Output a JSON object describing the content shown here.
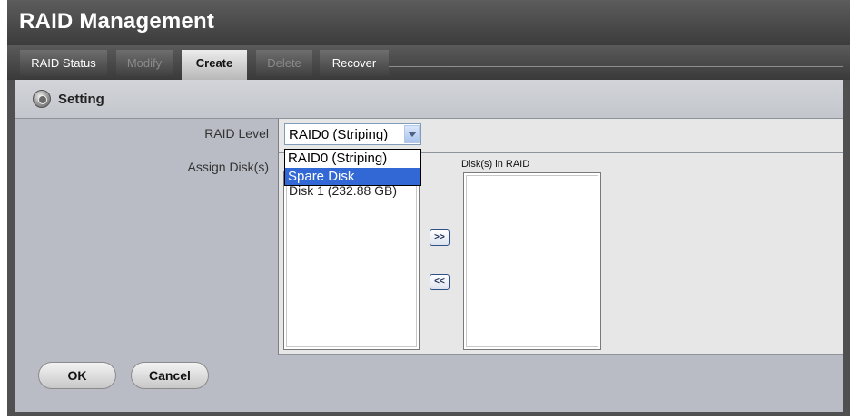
{
  "header": {
    "title": "RAID Management"
  },
  "tabs": [
    {
      "label": "RAID Status",
      "state": "normal"
    },
    {
      "label": "Modify",
      "state": "disabled"
    },
    {
      "label": "Create",
      "state": "active"
    },
    {
      "label": "Delete",
      "state": "disabled"
    },
    {
      "label": "Recover",
      "state": "normal"
    }
  ],
  "section": {
    "title": "Setting",
    "icon": "gear-icon"
  },
  "form": {
    "raid_level_label": "RAID Level",
    "raid_level_value": "RAID0 (Striping)",
    "raid_level_options": [
      "RAID0 (Striping)",
      "Spare Disk"
    ],
    "raid_level_highlighted": "Spare Disk",
    "assign_disks_label": "Assign Disk(s)",
    "available_disks": [
      "Disk 1 (232.88 GB)"
    ],
    "disks_in_raid_caption": "Disk(s) in RAID",
    "disks_in_raid": [],
    "add_button": ">>",
    "remove_button": "<<"
  },
  "footer": {
    "ok_label": "OK",
    "cancel_label": "Cancel"
  },
  "colors": {
    "frame": "#505050",
    "content": "#b9bcc4",
    "selection": "#3168d5"
  }
}
